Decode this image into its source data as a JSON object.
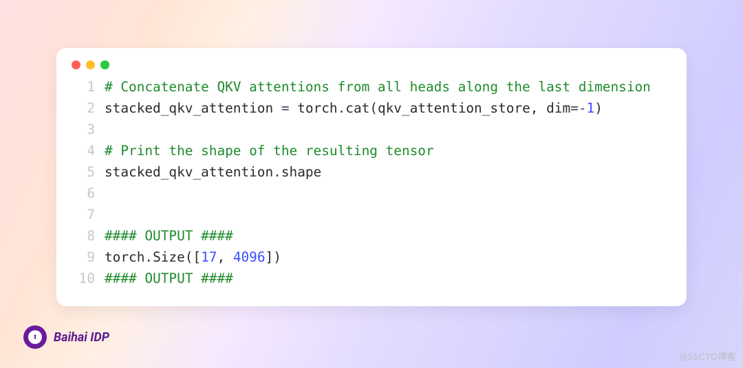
{
  "window": {
    "dots": [
      "red",
      "yellow",
      "green"
    ]
  },
  "code": {
    "lines": [
      {
        "n": "1",
        "tokens": [
          {
            "t": "# Concatenate QKV attentions from all heads along the last dimension",
            "c": "c-comment"
          }
        ]
      },
      {
        "n": "2",
        "tokens": [
          {
            "t": "stacked_qkv_attention ",
            "c": "c-default"
          },
          {
            "t": "=",
            "c": "c-op"
          },
          {
            "t": " torch",
            "c": "c-default"
          },
          {
            "t": ".",
            "c": "c-op"
          },
          {
            "t": "cat(qkv_attention_store, dim",
            "c": "c-default"
          },
          {
            "t": "=-",
            "c": "c-op"
          },
          {
            "t": "1",
            "c": "c-number"
          },
          {
            "t": ")",
            "c": "c-default"
          }
        ]
      },
      {
        "n": "3",
        "tokens": [
          {
            "t": "",
            "c": "c-default"
          }
        ]
      },
      {
        "n": "4",
        "tokens": [
          {
            "t": "# Print the shape of the resulting tensor",
            "c": "c-comment"
          }
        ]
      },
      {
        "n": "5",
        "tokens": [
          {
            "t": "stacked_qkv_attention",
            "c": "c-default"
          },
          {
            "t": ".",
            "c": "c-op"
          },
          {
            "t": "shape",
            "c": "c-default"
          }
        ]
      },
      {
        "n": "6",
        "tokens": [
          {
            "t": "",
            "c": "c-default"
          }
        ]
      },
      {
        "n": "7",
        "tokens": [
          {
            "t": "",
            "c": "c-default"
          }
        ]
      },
      {
        "n": "8",
        "tokens": [
          {
            "t": "#### OUTPUT ####",
            "c": "c-comment"
          }
        ]
      },
      {
        "n": "9",
        "tokens": [
          {
            "t": "torch",
            "c": "c-default"
          },
          {
            "t": ".",
            "c": "c-op"
          },
          {
            "t": "Size([",
            "c": "c-default"
          },
          {
            "t": "17",
            "c": "c-number"
          },
          {
            "t": ", ",
            "c": "c-default"
          },
          {
            "t": "4096",
            "c": "c-number"
          },
          {
            "t": "])",
            "c": "c-default"
          }
        ]
      },
      {
        "n": "10",
        "tokens": [
          {
            "t": "#### OUTPUT ####",
            "c": "c-comment"
          }
        ]
      }
    ]
  },
  "footer": {
    "brand": "Baihai IDP",
    "logo_glyph": "⬆"
  },
  "watermark": "@51CTO博客"
}
